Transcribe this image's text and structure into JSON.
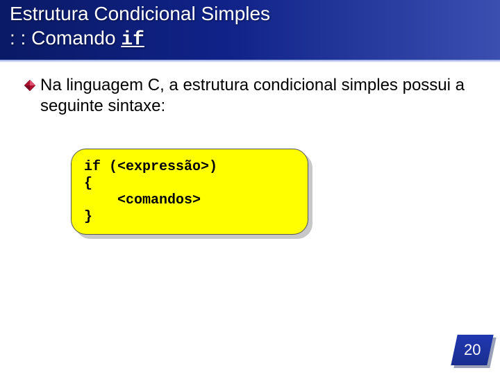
{
  "title": {
    "line1": "Estrutura Condicional Simples",
    "line2_prefix": ": : Comando ",
    "line2_keyword": "if"
  },
  "bullet": {
    "prefix": "Na linguagem C, a estrutura ",
    "highlight": "condicional simples",
    "suffix": " possui a seguinte sintaxe:"
  },
  "code": {
    "line1": "if (<expressão>)",
    "line2": "{",
    "line3": "    <comandos>",
    "line4": "}"
  },
  "page_number": "20",
  "icons": {
    "bullet": "diamond-icon"
  },
  "colors": {
    "accent": "#b01030",
    "band_start": "#0a1a66",
    "band_end": "#3a4fb0",
    "code_bg": "#ffff00"
  }
}
